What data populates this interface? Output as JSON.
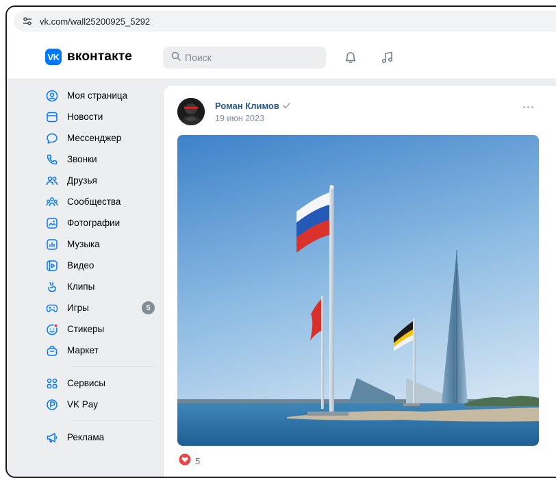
{
  "browser": {
    "url": "vk.com/wall25200925_5292"
  },
  "header": {
    "logo_mark": "VK",
    "logo_text": "вконтакте",
    "search_placeholder": "Поиск",
    "icons": [
      "bell-icon",
      "music-note-icon"
    ]
  },
  "sidebar": {
    "items": [
      {
        "label": "Моя страница",
        "icon": "user-circle-icon"
      },
      {
        "label": "Новости",
        "icon": "news-icon"
      },
      {
        "label": "Мессенджер",
        "icon": "chat-bubble-icon"
      },
      {
        "label": "Звонки",
        "icon": "phone-icon"
      },
      {
        "label": "Друзья",
        "icon": "friends-icon"
      },
      {
        "label": "Сообщества",
        "icon": "communities-icon"
      },
      {
        "label": "Фотографии",
        "icon": "photo-icon"
      },
      {
        "label": "Музыка",
        "icon": "music-icon"
      },
      {
        "label": "Видео",
        "icon": "video-icon"
      },
      {
        "label": "Клипы",
        "icon": "clips-icon"
      },
      {
        "label": "Игры",
        "icon": "gamepad-icon",
        "badge": "5"
      },
      {
        "label": "Стикеры",
        "icon": "sticker-icon"
      },
      {
        "label": "Маркет",
        "icon": "market-bag-icon"
      }
    ],
    "secondary": [
      {
        "label": "Сервисы",
        "icon": "services-grid-icon"
      },
      {
        "label": "VK Pay",
        "icon": "vkpay-icon"
      }
    ],
    "tertiary": [
      {
        "label": "Реклама",
        "icon": "megaphone-icon"
      }
    ]
  },
  "post": {
    "author": "Роман Климов",
    "date": "19 июн 2023",
    "likes": "5"
  },
  "colors": {
    "brand": "#0077ff",
    "link": "#2a5885",
    "like": "#e64646",
    "muted": "#818c99"
  }
}
